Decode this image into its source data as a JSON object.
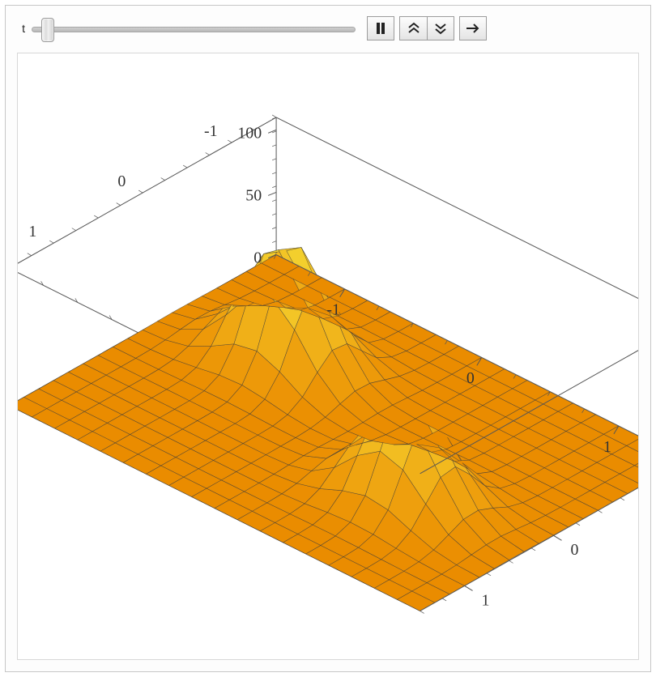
{
  "manipulate": {
    "param_label": "t",
    "slider": {
      "min": 0,
      "max": 1,
      "value": 0.03
    },
    "buttons": {
      "play_pause": "pause",
      "faster": "faster",
      "slower": "slower",
      "step": "step-forward"
    }
  },
  "chart_data": {
    "type": "surface3d",
    "title": "",
    "x_range": [
      -1.5,
      1.5
    ],
    "y_range": [
      -1.5,
      1.5
    ],
    "z_range": [
      0,
      110
    ],
    "x_ticks": [
      -1,
      0,
      1
    ],
    "y_ticks": [
      -1,
      0,
      1
    ],
    "z_ticks": [
      0,
      50,
      100
    ],
    "peaks": [
      {
        "x": -0.7,
        "y": -0.4,
        "height": 100
      },
      {
        "x": 0.7,
        "y": 0.4,
        "height": 85
      }
    ],
    "grid": {
      "nx": 18,
      "ny": 18
    },
    "colormap": [
      "#f4b400",
      "#ffd24a",
      "#ffec99"
    ]
  }
}
